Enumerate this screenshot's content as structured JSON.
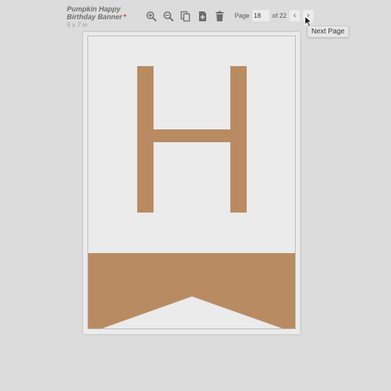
{
  "document": {
    "title": "Pumpkin Happy Birthday Banner",
    "unsaved_marker": "*",
    "size": "5 x 7 in"
  },
  "toolbar": {
    "icons": [
      "zoom-in-icon",
      "zoom-out-icon",
      "duplicate-icon",
      "add-page-icon",
      "trash-icon"
    ]
  },
  "pager": {
    "page_label": "Page",
    "current_page": "18",
    "of_label": "of 22",
    "prev_symbol": "‹",
    "next_symbol": "›"
  },
  "tooltip": {
    "text": "Next Page"
  },
  "canvas": {
    "letter": "H",
    "accent_color": "#b98b62",
    "background_color": "#ebebeb"
  }
}
